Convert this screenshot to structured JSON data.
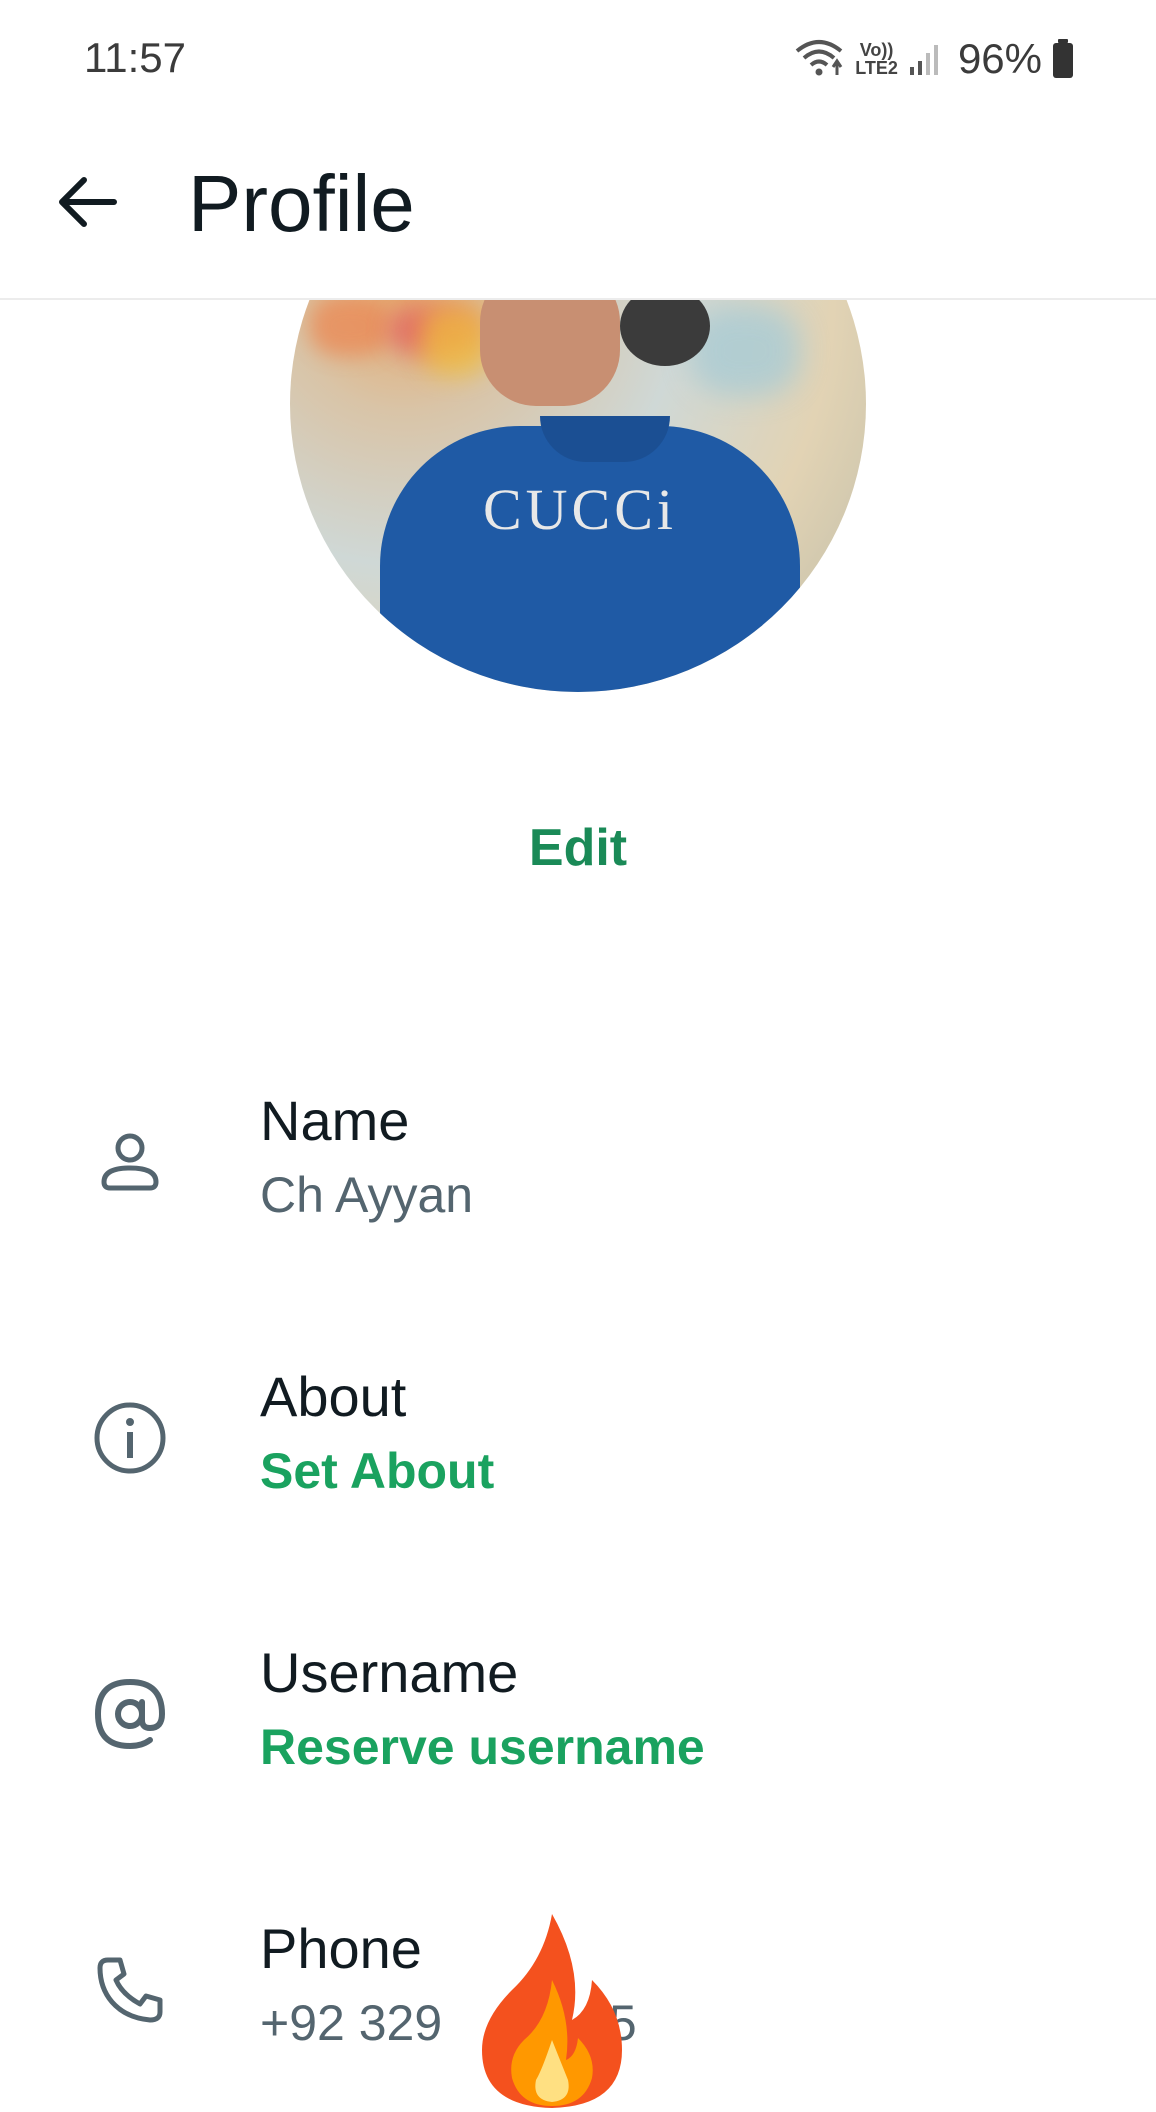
{
  "status_bar": {
    "time": "11:57",
    "volte_top": "Vo))",
    "volte_bottom": "LTE2",
    "battery": "96%"
  },
  "app_bar": {
    "title": "Profile"
  },
  "profile": {
    "shirt_logo": "CUCCi",
    "edit_label": "Edit"
  },
  "rows": [
    {
      "icon": "person-icon",
      "label": "Name",
      "value": "Ch Ayyan"
    },
    {
      "icon": "info-icon",
      "label": "About",
      "value": "Set About"
    },
    {
      "icon": "at-icon",
      "label": "Username",
      "value": "Reserve username"
    },
    {
      "icon": "phone-icon",
      "label": "Phone",
      "value": "+92 329          35"
    }
  ],
  "colors": {
    "accent": "#1aa25f",
    "edit": "#1a8a57",
    "secondary_text": "#54656f",
    "icon": "#54656f"
  }
}
